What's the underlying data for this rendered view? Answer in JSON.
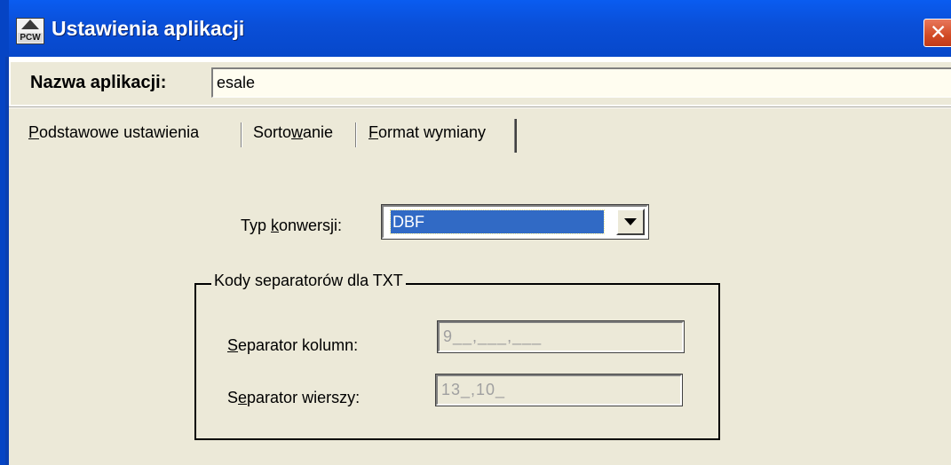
{
  "window": {
    "title": "Ustawienia aplikacji",
    "icon": "app-house-icon",
    "icon_text": "PCW"
  },
  "app_name": {
    "label": "Nazwa aplikacji:",
    "value": "esale"
  },
  "tabs": [
    {
      "label_u": "P",
      "label_rest": "odstawowe ustawienia",
      "active": false
    },
    {
      "label_pre": "Sorto",
      "label_u": "w",
      "label_rest": "anie",
      "active": false
    },
    {
      "label_u": "F",
      "label_rest": "ormat wymiany",
      "active": true
    }
  ],
  "conversion": {
    "label_pre": "Typ ",
    "label_u": "k",
    "label_rest": "onwersji:",
    "selected": "DBF"
  },
  "separators": {
    "group_title": "Kody separatorów dla TXT",
    "column": {
      "label_u": "S",
      "label_rest": "eparator kolumn:",
      "value": "9__,___,___"
    },
    "row": {
      "label_pre": "S",
      "label_u": "e",
      "label_rest": "parator wierszy:",
      "value": "13_,10_"
    }
  },
  "colors": {
    "titlebar": "#0a4fd8",
    "selection": "#316ac5",
    "face": "#ece9d8",
    "close": "#d24b25"
  }
}
